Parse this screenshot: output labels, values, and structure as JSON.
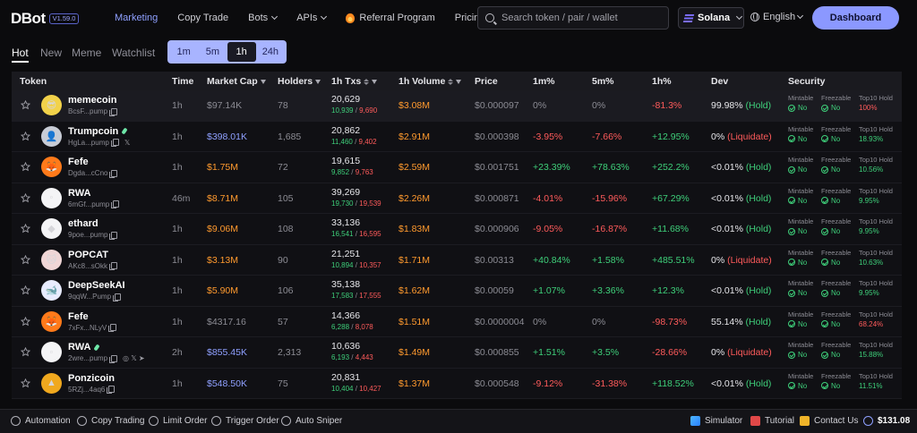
{
  "header": {
    "logo": "DBot",
    "version": "V1.59.0",
    "nav": [
      {
        "label": "Marketing",
        "active": true,
        "dropdown": false,
        "icon": ""
      },
      {
        "label": "Copy Trade",
        "active": false,
        "dropdown": false,
        "icon": ""
      },
      {
        "label": "Bots",
        "active": false,
        "dropdown": true,
        "icon": ""
      },
      {
        "label": "APIs",
        "active": false,
        "dropdown": true,
        "icon": ""
      },
      {
        "label": "Referral Program",
        "active": false,
        "dropdown": false,
        "icon": "fire-icon"
      },
      {
        "label": "Pricing",
        "active": false,
        "dropdown": false,
        "icon": ""
      }
    ],
    "search_placeholder": "Search token / pair / wallet",
    "chain": "Solana",
    "language": "English",
    "dashboard_label": "Dashboard"
  },
  "tabs": [
    "Hot",
    "New",
    "Meme",
    "Watchlist"
  ],
  "active_tab": "Hot",
  "timeframes": [
    "1m",
    "5m",
    "1h",
    "24h"
  ],
  "active_timeframe": "1h",
  "table": {
    "columns": {
      "token": "Token",
      "time": "Time",
      "market_cap": "Market Cap",
      "holders": "Holders",
      "txs": "1h Txs",
      "volume": "1h Volume",
      "price": "Price",
      "p1m": "1m%",
      "p5m": "5m%",
      "p1h": "1h%",
      "dev": "Dev",
      "security": "Security"
    },
    "security_labels": {
      "mintable": "Mintable",
      "freezable": "Freezable",
      "top10": "Top10 Hold"
    },
    "rows": [
      {
        "name": "memecoin",
        "addr": "BcsF...pump",
        "avatar_color": "#f2d24a",
        "avatar_glyph": "😎",
        "pill": false,
        "socials": "",
        "time": "1h",
        "mcap": "$97.14K",
        "mcap_color": "grey",
        "holders": "78",
        "txs": "20,629",
        "buys": "10,939",
        "sells": "9,690",
        "volume": "$3.08M",
        "price": "$0.000097",
        "p1m": "0%",
        "p1m_c": "grey",
        "p5m": "0%",
        "p5m_c": "grey",
        "p1h": "-81.3%",
        "p1h_c": "red",
        "dev_pct": "99.98%",
        "dev_status": "(Hold)",
        "dev_c": "green",
        "mintable": "No",
        "freezable": "No",
        "top10": "100%",
        "top10_c": "red",
        "highlight": true
      },
      {
        "name": "Trumpcoin",
        "addr": "HgLa...pump",
        "avatar_color": "#c8ccd6",
        "avatar_glyph": "👤",
        "pill": true,
        "socials": "𝕏",
        "time": "1h",
        "mcap": "$398.01K",
        "mcap_color": "blue",
        "holders": "1,685",
        "txs": "20,862",
        "buys": "11,460",
        "sells": "9,402",
        "volume": "$2.91M",
        "price": "$0.000398",
        "p1m": "-3.95%",
        "p1m_c": "red",
        "p5m": "-7.66%",
        "p5m_c": "red",
        "p1h": "+12.95%",
        "p1h_c": "green",
        "dev_pct": "0%",
        "dev_status": "(Liquidate)",
        "dev_c": "red",
        "mintable": "No",
        "freezable": "No",
        "top10": "18.93%",
        "top10_c": "green",
        "highlight": false
      },
      {
        "name": "Fefe",
        "addr": "Dgda...cCno",
        "avatar_color": "#ff7a1a",
        "avatar_glyph": "🦊",
        "pill": false,
        "socials": "",
        "time": "1h",
        "mcap": "$1.75M",
        "mcap_color": "orange",
        "holders": "72",
        "txs": "19,615",
        "buys": "9,852",
        "sells": "9,763",
        "volume": "$2.59M",
        "price": "$0.001751",
        "p1m": "+23.39%",
        "p1m_c": "green",
        "p5m": "+78.63%",
        "p5m_c": "green",
        "p1h": "+252.2%",
        "p1h_c": "green",
        "dev_pct": "<0.01%",
        "dev_status": "(Hold)",
        "dev_c": "green",
        "mintable": "No",
        "freezable": "No",
        "top10": "10.56%",
        "top10_c": "green",
        "highlight": false
      },
      {
        "name": "RWA",
        "addr": "6mGf...pump",
        "avatar_color": "#f4f4f6",
        "avatar_glyph": "◦",
        "pill": false,
        "socials": "",
        "time": "46m",
        "mcap": "$8.71M",
        "mcap_color": "orange",
        "holders": "105",
        "txs": "39,269",
        "buys": "19,730",
        "sells": "19,539",
        "volume": "$2.26M",
        "price": "$0.000871",
        "p1m": "-4.01%",
        "p1m_c": "red",
        "p5m": "-15.96%",
        "p5m_c": "red",
        "p1h": "+67.29%",
        "p1h_c": "green",
        "dev_pct": "<0.01%",
        "dev_status": "(Hold)",
        "dev_c": "green",
        "mintable": "No",
        "freezable": "No",
        "top10": "9.95%",
        "top10_c": "green",
        "highlight": false
      },
      {
        "name": "ethard",
        "addr": "9poe...pump",
        "avatar_color": "#f4f4f6",
        "avatar_glyph": "◆",
        "pill": false,
        "socials": "",
        "time": "1h",
        "mcap": "$9.06M",
        "mcap_color": "orange",
        "holders": "108",
        "txs": "33,136",
        "buys": "16,541",
        "sells": "16,595",
        "volume": "$1.83M",
        "price": "$0.000906",
        "p1m": "-9.05%",
        "p1m_c": "red",
        "p5m": "-16.87%",
        "p5m_c": "red",
        "p1h": "+11.68%",
        "p1h_c": "green",
        "dev_pct": "<0.01%",
        "dev_status": "(Hold)",
        "dev_c": "green",
        "mintable": "No",
        "freezable": "No",
        "top10": "9.95%",
        "top10_c": "green",
        "highlight": false
      },
      {
        "name": "POPCAT",
        "addr": "AKc8...sOkk",
        "avatar_color": "#f0d6d6",
        "avatar_glyph": "🐱",
        "pill": false,
        "socials": "",
        "time": "1h",
        "mcap": "$3.13M",
        "mcap_color": "orange",
        "holders": "90",
        "txs": "21,251",
        "buys": "10,894",
        "sells": "10,357",
        "volume": "$1.71M",
        "price": "$0.00313",
        "p1m": "+40.84%",
        "p1m_c": "green",
        "p5m": "+1.58%",
        "p5m_c": "green",
        "p1h": "+485.51%",
        "p1h_c": "green",
        "dev_pct": "0%",
        "dev_status": "(Liquidate)",
        "dev_c": "red",
        "mintable": "No",
        "freezable": "No",
        "top10": "10.63%",
        "top10_c": "green",
        "highlight": false
      },
      {
        "name": "DeepSeekAI",
        "addr": "9qqW...Pump",
        "avatar_color": "#e8ecff",
        "avatar_glyph": "🐋",
        "pill": false,
        "socials": "",
        "time": "1h",
        "mcap": "$5.90M",
        "mcap_color": "orange",
        "holders": "106",
        "txs": "35,138",
        "buys": "17,583",
        "sells": "17,555",
        "volume": "$1.62M",
        "price": "$0.00059",
        "p1m": "+1.07%",
        "p1m_c": "green",
        "p5m": "+3.36%",
        "p5m_c": "green",
        "p1h": "+12.3%",
        "p1h_c": "green",
        "dev_pct": "<0.01%",
        "dev_status": "(Hold)",
        "dev_c": "green",
        "mintable": "No",
        "freezable": "No",
        "top10": "9.95%",
        "top10_c": "green",
        "highlight": false
      },
      {
        "name": "Fefe",
        "addr": "7xFx...NLyV",
        "avatar_color": "#ff7a1a",
        "avatar_glyph": "🦊",
        "pill": false,
        "socials": "",
        "time": "1h",
        "mcap": "$4317.16",
        "mcap_color": "grey",
        "holders": "57",
        "txs": "14,366",
        "buys": "6,288",
        "sells": "8,078",
        "volume": "$1.51M",
        "price": "$0.0000004",
        "p1m": "0%",
        "p1m_c": "grey",
        "p5m": "0%",
        "p5m_c": "grey",
        "p1h": "-98.73%",
        "p1h_c": "red",
        "dev_pct": "55.14%",
        "dev_status": "(Hold)",
        "dev_c": "green",
        "mintable": "No",
        "freezable": "No",
        "top10": "68.24%",
        "top10_c": "red",
        "highlight": false
      },
      {
        "name": "RWA",
        "addr": "2wre...pump",
        "avatar_color": "#f4f4f6",
        "avatar_glyph": "◦",
        "pill": true,
        "socials": "◎ 𝕏 ➤",
        "time": "2h",
        "mcap": "$855.45K",
        "mcap_color": "blue",
        "holders": "2,313",
        "txs": "10,636",
        "buys": "6,193",
        "sells": "4,443",
        "volume": "$1.49M",
        "price": "$0.000855",
        "p1m": "+1.51%",
        "p1m_c": "green",
        "p5m": "+3.5%",
        "p5m_c": "green",
        "p1h": "-28.66%",
        "p1h_c": "red",
        "dev_pct": "0%",
        "dev_status": "(Liquidate)",
        "dev_c": "red",
        "mintable": "No",
        "freezable": "No",
        "top10": "15.88%",
        "top10_c": "green",
        "highlight": false
      },
      {
        "name": "Ponzicoin",
        "addr": "5RZj...4aq6",
        "avatar_color": "#f0a81e",
        "avatar_glyph": "▲",
        "pill": false,
        "socials": "",
        "time": "1h",
        "mcap": "$548.50K",
        "mcap_color": "blue",
        "holders": "75",
        "txs": "20,831",
        "buys": "10,404",
        "sells": "10,427",
        "volume": "$1.37M",
        "price": "$0.000548",
        "p1m": "-9.12%",
        "p1m_c": "red",
        "p5m": "-31.38%",
        "p5m_c": "red",
        "p1h": "+118.52%",
        "p1h_c": "green",
        "dev_pct": "<0.01%",
        "dev_status": "(Hold)",
        "dev_c": "green",
        "mintable": "No",
        "freezable": "No",
        "top10": "11.51%",
        "top10_c": "green",
        "highlight": false
      }
    ]
  },
  "footer": {
    "left": [
      {
        "label": "Automation",
        "icon": "automation-icon"
      },
      {
        "label": "Copy Trading",
        "icon": "copy-trading-icon"
      },
      {
        "label": "Limit Order",
        "icon": "limit-order-icon"
      },
      {
        "label": "Trigger Order",
        "icon": "trigger-order-icon"
      },
      {
        "label": "Auto Sniper",
        "icon": "auto-sniper-icon"
      }
    ],
    "right": [
      {
        "label": "Simulator",
        "icon": "simulator-icon"
      },
      {
        "label": "Tutorial",
        "icon": "tutorial-icon"
      },
      {
        "label": "Contact Us",
        "icon": "contact-icon"
      }
    ],
    "balance": "$131.08"
  },
  "colors": {
    "accent": "#8fa0ff",
    "green": "#3ecf7a",
    "red": "#ff5b5b",
    "orange": "#ff9a2e",
    "background": "#0b0b0d"
  }
}
